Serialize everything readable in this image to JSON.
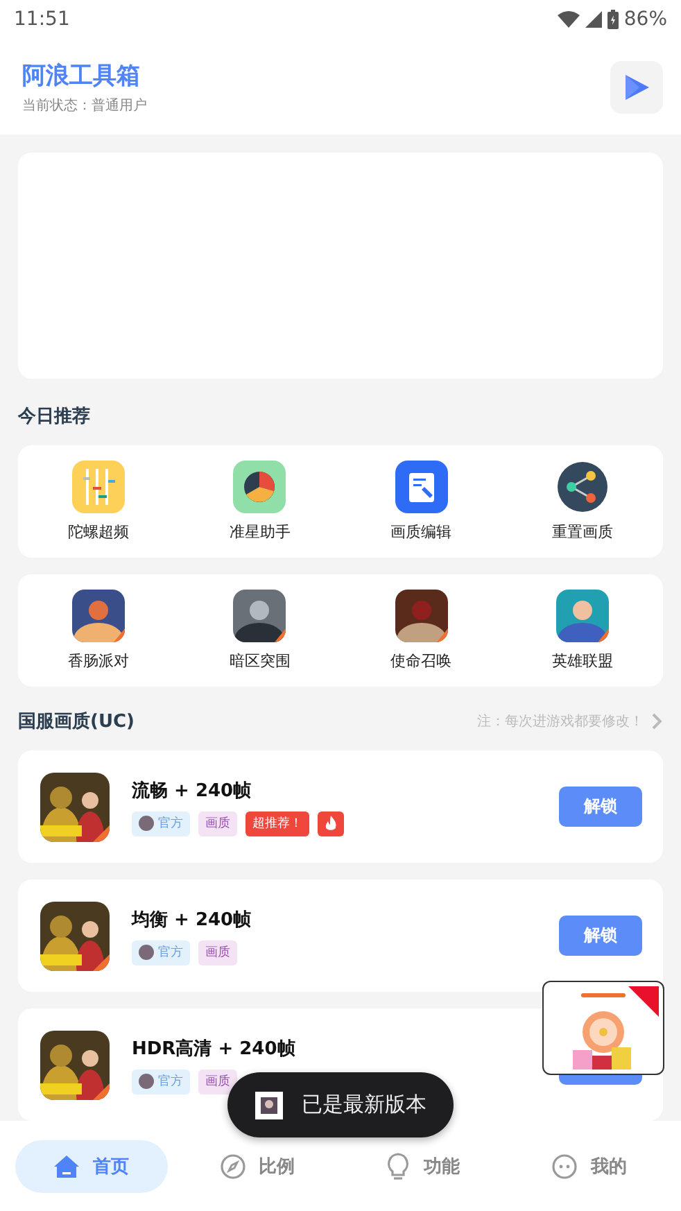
{
  "status_bar": {
    "time": "11:51",
    "battery": "86%"
  },
  "header": {
    "title": "阿浪工具箱",
    "subtitle": "当前状态：普通用户"
  },
  "section_today": {
    "title": "今日推荐"
  },
  "tools": [
    {
      "kind": "sliders",
      "label": "陀螺超频"
    },
    {
      "kind": "pie",
      "label": "准星助手"
    },
    {
      "kind": "edit",
      "label": "画质编辑"
    },
    {
      "kind": "share",
      "label": "重置画质"
    }
  ],
  "games": [
    {
      "kind": "picture",
      "label": "香肠派对"
    },
    {
      "kind": "picture",
      "label": "暗区突围"
    },
    {
      "kind": "picture",
      "label": "使命召唤"
    },
    {
      "kind": "picture",
      "label": "英雄联盟"
    }
  ],
  "section_cn": {
    "title": "国服画质(UC)",
    "note": "注：每次进游戏都要修改！"
  },
  "presets": [
    {
      "title": "流畅 + 240帧",
      "button": "解锁",
      "tags": [
        {
          "kind": "official",
          "text": "官方"
        },
        {
          "kind": "type",
          "text": "画质"
        },
        {
          "kind": "hot",
          "text": "超推荐！"
        },
        {
          "kind": "fire"
        }
      ]
    },
    {
      "title": "均衡 + 240帧",
      "button": "解锁",
      "tags": [
        {
          "kind": "official",
          "text": "官方"
        },
        {
          "kind": "type",
          "text": "画质"
        }
      ]
    },
    {
      "title": "HDR高清 + 240帧",
      "tags": [
        {
          "kind": "official",
          "text": "官方"
        },
        {
          "kind": "type",
          "text": "画质"
        }
      ]
    }
  ],
  "toast": {
    "text": "已是最新版本"
  },
  "nav": [
    {
      "kind": "home",
      "label": "首页",
      "selected": true
    },
    {
      "kind": "compass",
      "label": "比例",
      "selected": false
    },
    {
      "kind": "bulb",
      "label": "功能",
      "selected": false
    },
    {
      "kind": "face",
      "label": "我的",
      "selected": false
    }
  ]
}
